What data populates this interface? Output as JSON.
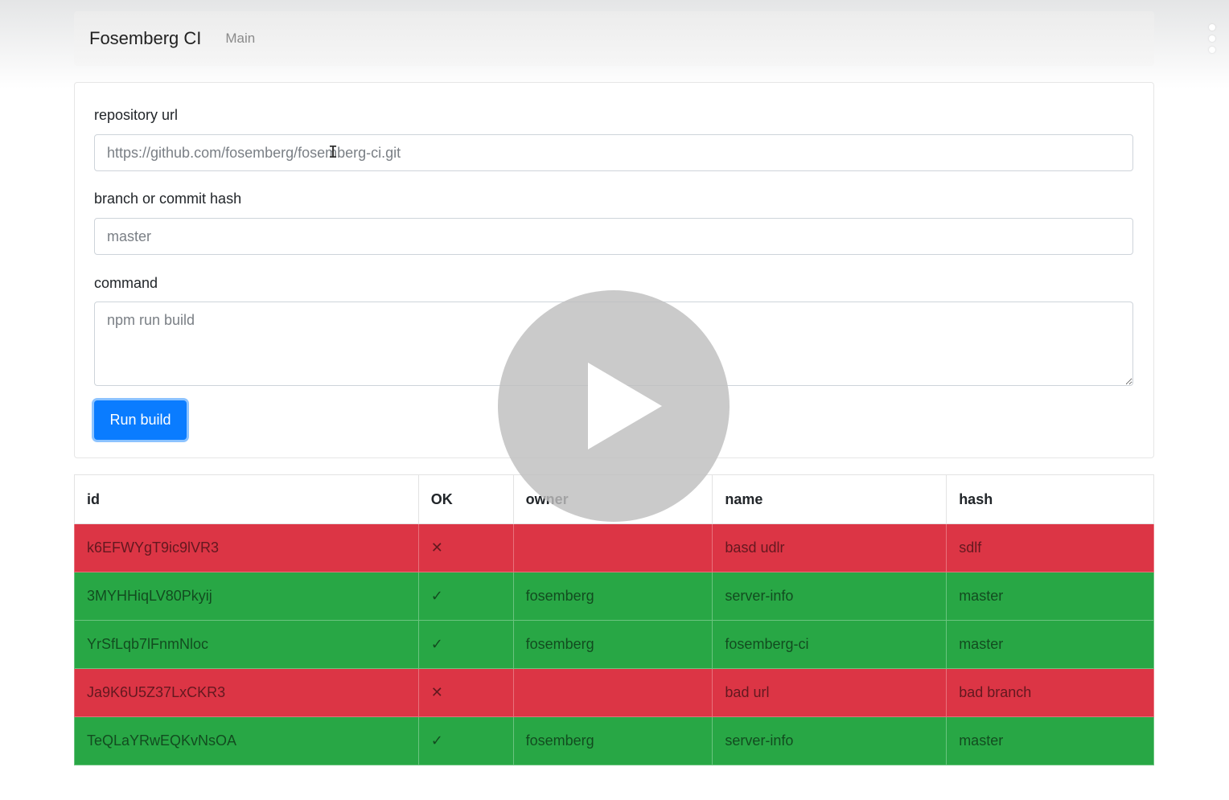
{
  "navbar": {
    "brand": "Fosemberg CI",
    "links": [
      "Main"
    ]
  },
  "form": {
    "repo_label": "repository url",
    "repo_placeholder": "https://github.com/fosemberg/fosemberg-ci.git",
    "branch_label": "branch or commit hash",
    "branch_placeholder": "master",
    "command_label": "command",
    "command_placeholder": "npm run build",
    "run_label": "Run build"
  },
  "table": {
    "headers": [
      "id",
      "OK",
      "owner",
      "name",
      "hash"
    ],
    "rows": [
      {
        "id": "k6EFWYgT9ic9lVR3",
        "ok": "✕",
        "owner": "",
        "name": "basd udlr",
        "hash": "sdlf",
        "status": "fail"
      },
      {
        "id": "3MYHHiqLV80Pkyij",
        "ok": "✓",
        "owner": "fosemberg",
        "name": "server-info",
        "hash": "master",
        "status": "ok"
      },
      {
        "id": "YrSfLqb7lFnmNloc",
        "ok": "✓",
        "owner": "fosemberg",
        "name": "fosemberg-ci",
        "hash": "master",
        "status": "ok"
      },
      {
        "id": "Ja9K6U5Z37LxCKR3",
        "ok": "✕",
        "owner": "",
        "name": "bad url",
        "hash": "bad branch",
        "status": "fail"
      },
      {
        "id": "TeQLaYRwEQKvNsOA",
        "ok": "✓",
        "owner": "fosemberg",
        "name": "server-info",
        "hash": "master",
        "status": "ok"
      }
    ]
  },
  "colors": {
    "fail": "#dc3545",
    "ok": "#28a745",
    "primary": "#0a7cff"
  },
  "icons": {
    "overlay": "play-icon",
    "menu": "more-vertical-icon",
    "cursor": "text-cursor-icon"
  }
}
